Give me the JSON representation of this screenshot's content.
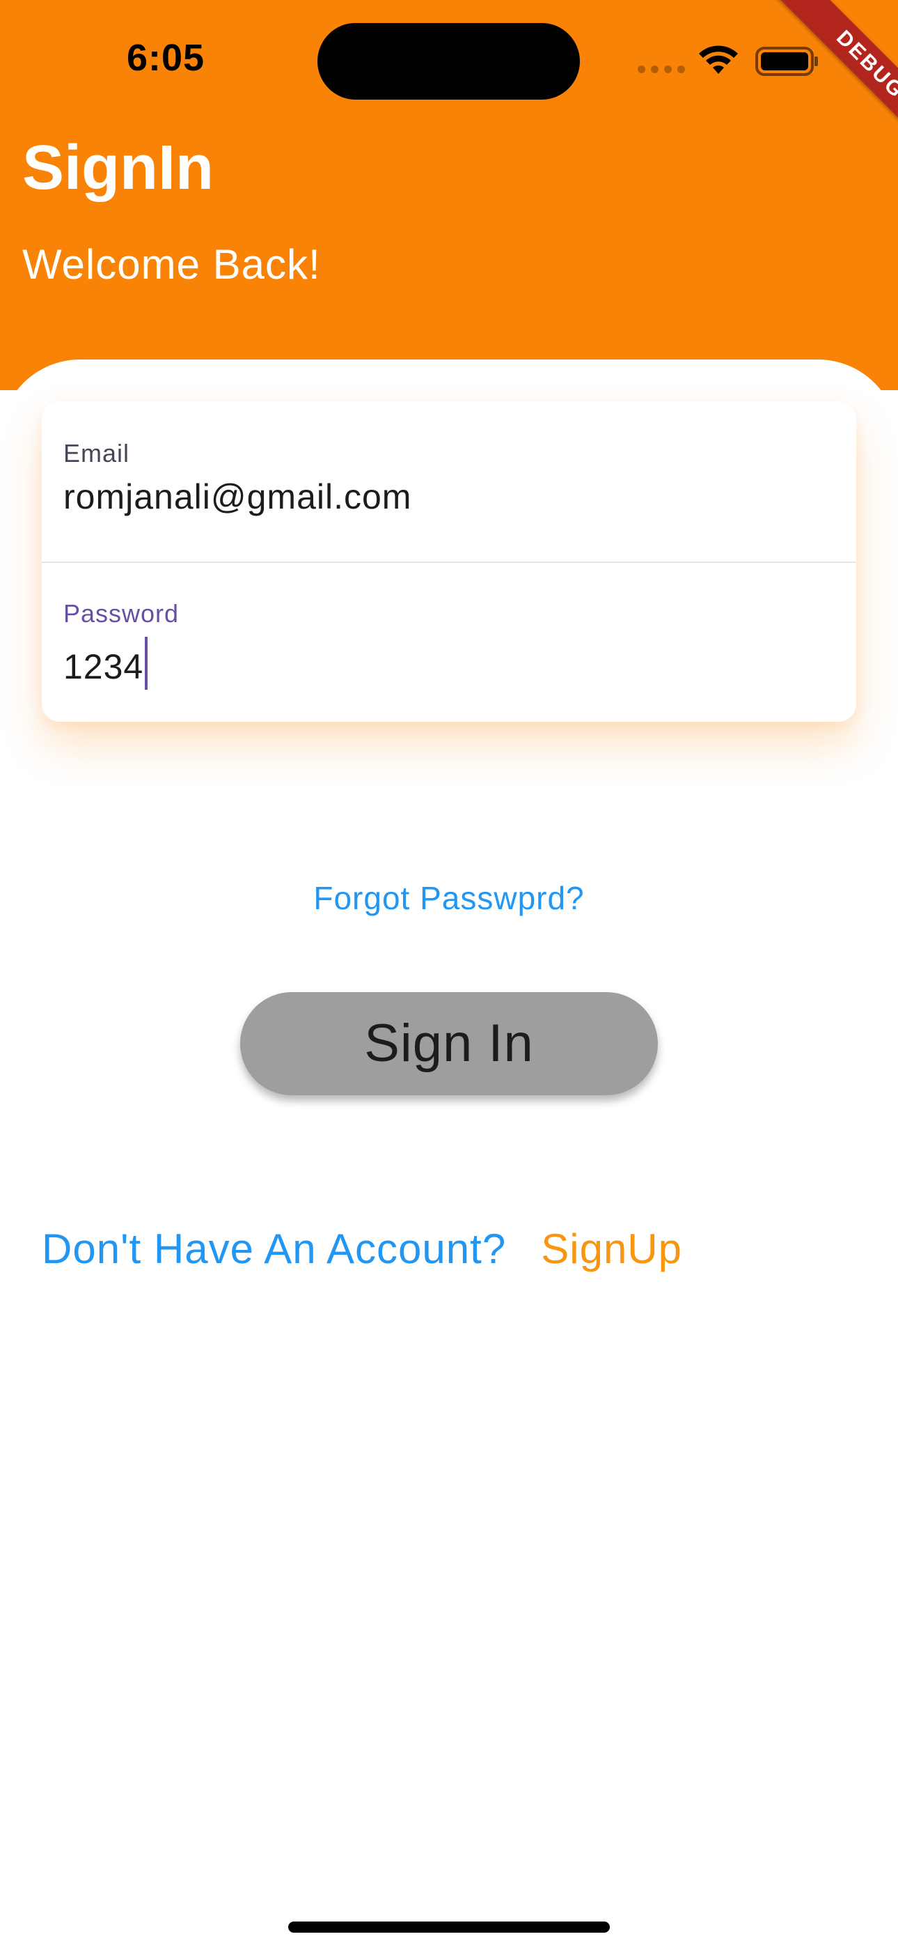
{
  "status_bar": {
    "time": "6:05",
    "wifi_icon": "wifi-icon",
    "battery_icon": "battery-icon",
    "signal_icon": "cellular-signal-icon"
  },
  "debug_banner": "DEBUG",
  "header": {
    "title": "SignIn",
    "subtitle": "Welcome Back!",
    "background_color": "#f88306"
  },
  "form": {
    "email": {
      "label": "Email",
      "value": "romjanali@gmail.com"
    },
    "password": {
      "label": "Password",
      "value": "1234",
      "focused": true
    }
  },
  "forgot_password_link": "Forgot Passwprd?",
  "sign_in_button": "Sign In",
  "signup_prompt": {
    "text": "Don't Have An Account?",
    "link": "SignUp"
  },
  "colors": {
    "accent": "#f88306",
    "link": "#2196f3",
    "signup_link": "#f8960f",
    "button": "#9e9e9e",
    "focus": "#6750a4"
  }
}
